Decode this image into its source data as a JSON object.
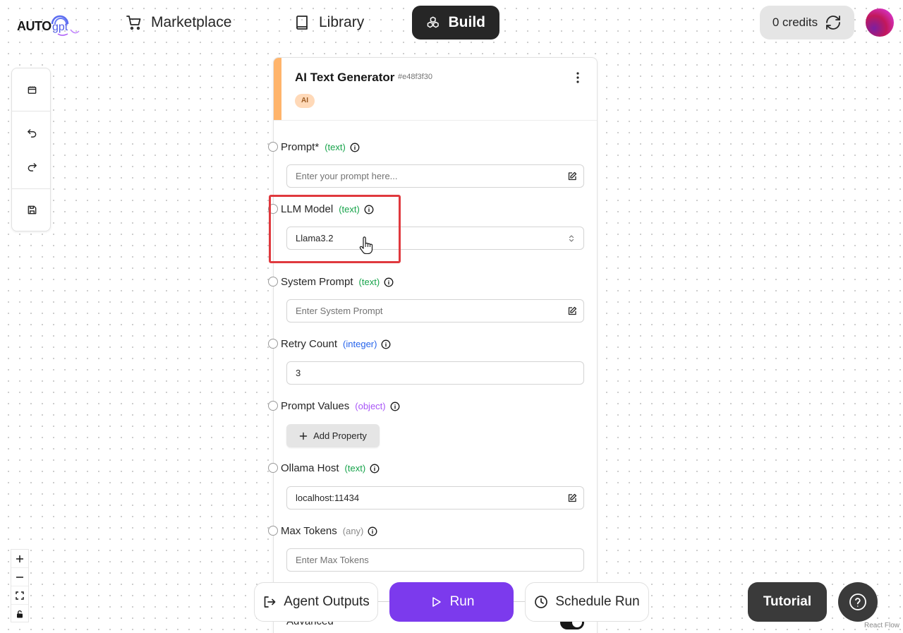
{
  "header": {
    "logo_text": "AUTOgpt",
    "nav": [
      {
        "label": "Marketplace",
        "icon": "cart-icon"
      },
      {
        "label": "Library",
        "icon": "book-icon"
      },
      {
        "label": "Build",
        "icon": "blocks-icon",
        "active": true
      }
    ],
    "credits_label": "0 credits",
    "accent_color": "#7c3aed"
  },
  "toolbar": {
    "items": [
      "blocks-icon",
      "undo-icon",
      "redo-icon",
      "save-icon"
    ]
  },
  "node": {
    "title": "AI Text Generator",
    "id": "#e48f3f30",
    "badge": "AI",
    "accent_color": "#ffb46b",
    "fields": [
      {
        "label": "Prompt*",
        "type": "(text)",
        "placeholder": "Enter your prompt here...",
        "value": ""
      },
      {
        "label": "LLM Model",
        "type": "(text)",
        "value": "Llama3.2"
      },
      {
        "label": "System Prompt",
        "type": "(text)",
        "placeholder": "Enter System Prompt",
        "value": ""
      },
      {
        "label": "Retry Count",
        "type": "(integer)",
        "value": "3"
      },
      {
        "label": "Prompt Values",
        "type": "(object)",
        "button": "Add Property"
      },
      {
        "label": "Ollama Host",
        "type": "(text)",
        "value": "localhost:11434"
      },
      {
        "label": "Max Tokens",
        "type": "(any)",
        "placeholder": "Enter Max Tokens",
        "value": ""
      }
    ],
    "advanced_label": "Advanced"
  },
  "bottom_bar": {
    "outputs_label": "Agent Outputs",
    "run_label": "Run",
    "schedule_label": "Schedule Run"
  },
  "tutorial_label": "Tutorial",
  "attribution": "React Flow"
}
